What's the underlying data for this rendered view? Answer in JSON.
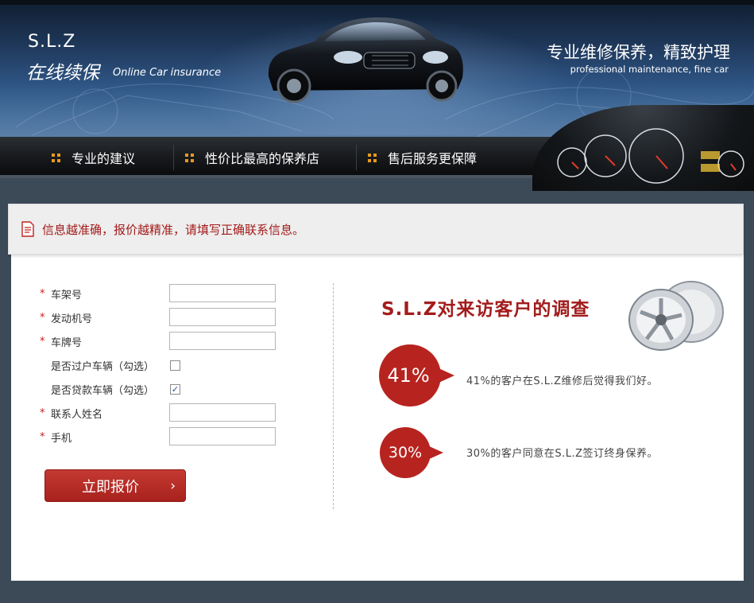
{
  "header": {
    "brand_name": "S.L.Z",
    "brand_cn": "在线续保",
    "brand_en": "Online Car insurance",
    "slogan_cn": "专业维修保养，精致护理",
    "slogan_en": "professional maintenance, fine car"
  },
  "nav": {
    "items": [
      {
        "label": "专业的建议",
        "icon": "grid-dots-icon"
      },
      {
        "label": "性价比最高的保养店",
        "icon": "grid-dots-icon"
      },
      {
        "label": "售后服务更保障",
        "icon": "grid-dots-icon"
      }
    ]
  },
  "notice": {
    "text": "信息越准确，报价越精准，请填写正确联系信息。",
    "icon": "document-icon"
  },
  "form": {
    "fields": [
      {
        "label": "车架号",
        "required": true,
        "value": ""
      },
      {
        "label": "发动机号",
        "required": true,
        "value": ""
      },
      {
        "label": "车牌号",
        "required": true,
        "value": ""
      },
      {
        "label": "是否过户车辆（勾选）",
        "required": false,
        "checked": false
      },
      {
        "label": "是否贷款车辆（勾选）",
        "required": false,
        "checked": true
      },
      {
        "label": "联系人姓名",
        "required": true,
        "value": ""
      },
      {
        "label": "手机",
        "required": true,
        "value": ""
      }
    ],
    "required_mark": "*",
    "check_mark": "✓",
    "submit_label": "立即报价",
    "submit_arrow": "›"
  },
  "survey": {
    "title": "S.L.Z对来访客户的调查",
    "stats": [
      {
        "percent": "41%",
        "text": "41%的客户在S.L.Z维修后觉得我们好。"
      },
      {
        "percent": "30%",
        "text": "30%的客户同意在S.L.Z签订终身保养。"
      }
    ]
  },
  "colors": {
    "accent": "#a31c1c",
    "nav_dots": "#e89a1f",
    "bubble": "#b7241f"
  }
}
